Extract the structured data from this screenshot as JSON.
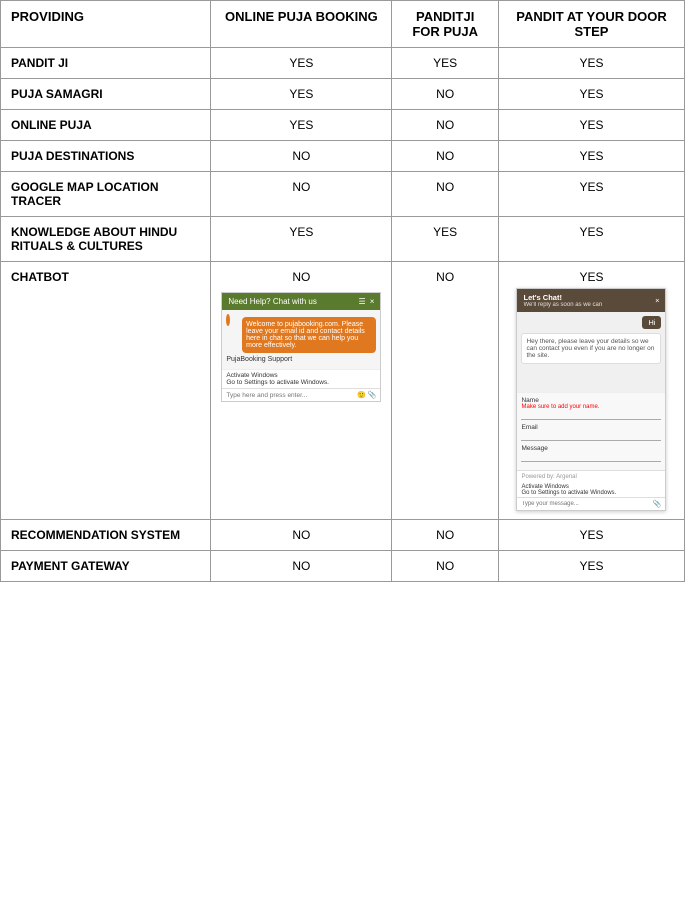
{
  "table": {
    "headers": [
      "PROVIDING",
      "ONLINE PUJA BOOKING",
      "PANDITJI FOR PUJA",
      "PANDIT AT YOUR DOOR STEP"
    ],
    "rows": [
      {
        "feature": "PANDIT JI",
        "col1": "YES",
        "col2": "YES",
        "col3": "YES"
      },
      {
        "feature": "PUJA SAMAGRI",
        "col1": "YES",
        "col2": "NO",
        "col3": "YES"
      },
      {
        "feature": "ONLINE PUJA",
        "col1": "YES",
        "col2": "NO",
        "col3": "YES"
      },
      {
        "feature": "PUJA DESTINATIONS",
        "col1": "NO",
        "col2": "NO",
        "col3": "YES"
      },
      {
        "feature": "GOOGLE MAP LOCATION TRACER",
        "col1": "NO",
        "col2": "NO",
        "col3": "YES"
      },
      {
        "feature": "KNOWLEDGE ABOUT HINDU RITUALS & CULTURES",
        "col1": "YES",
        "col2": "YES",
        "col3": "YES"
      },
      {
        "feature": "CHATBOT",
        "col1": "NO",
        "col2": "NO",
        "col3": "YES"
      },
      {
        "feature": "RECOMMENDATION SYSTEM",
        "col1": "NO",
        "col2": "NO",
        "col3": "YES"
      },
      {
        "feature": "PAYMENT GATEWAY",
        "col1": "NO",
        "col2": "NO",
        "col3": "YES"
      }
    ]
  },
  "chatbot_widget1": {
    "header": "Need Help? Chat with us",
    "menu_icon": "☰",
    "close_icon": "×",
    "message": "Welcome to pujabooking.com. Please leave your email id and contact details here in chat so that we can help you more effectively.",
    "sender": "PujaBooking Support",
    "footer": "Activate Windows",
    "footer_sub": "Go to Settings to activate Windows.",
    "input_placeholder": "Type here and press enter..."
  },
  "chatbot_widget2": {
    "header": "Let's Chat!",
    "header_sub": "We'll reply as soon as we can",
    "close_icon": "×",
    "hi_bubble": "Hi",
    "agent_message": "Hey there, please leave your details so we can contact you even if you are no longer on the site.",
    "name_label": "Name",
    "name_error": "Make sure to add your name.",
    "email_label": "Email",
    "message_label": "Message",
    "footer": "Powered by: Argenal",
    "activate_notice": "Activate Windows",
    "activate_sub": "Go to Settings to activate Windows.",
    "input_placeholder": "Type your message...",
    "paperclip_icon": "📎"
  }
}
